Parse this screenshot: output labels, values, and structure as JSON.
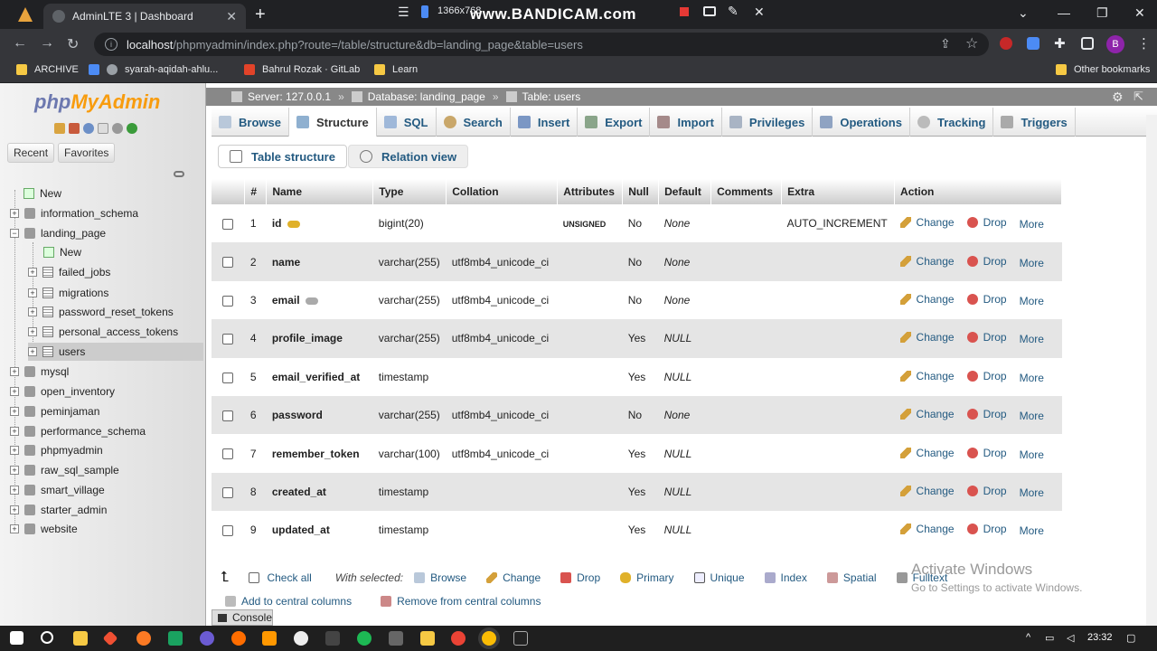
{
  "browser": {
    "tab_title": "AdminLTE 3 | Dashboard",
    "recording_res": "1366x768",
    "watermark": "www.BANDICAM.com",
    "url_host": "localhost",
    "url_path": "/phpmyadmin/index.php?route=/table/structure&db=landing_page&table=users",
    "profile_initial": "B",
    "bookmarks": [
      "ARCHIVE",
      "syarah-aqidah-ahlu...",
      "Bahrul Rozak · GitLab",
      "Learn"
    ],
    "other_bookmarks": "Other bookmarks"
  },
  "pma": {
    "logo_php": "php",
    "logo_my": "MyAdmin",
    "recent": "Recent",
    "favorites": "Favorites",
    "tree": {
      "new": "New",
      "dbs": [
        "information_schema",
        "landing_page",
        "mysql",
        "open_inventory",
        "peminjaman",
        "performance_schema",
        "phpmyadmin",
        "raw_sql_sample",
        "smart_village",
        "starter_admin",
        "website"
      ],
      "landing_new": "New",
      "tables": [
        "failed_jobs",
        "migrations",
        "password_reset_tokens",
        "personal_access_tokens",
        "users"
      ]
    },
    "breadcrumb": {
      "server": "Server: 127.0.0.1",
      "database": "Database: landing_page",
      "table": "Table: users"
    },
    "tabs": [
      "Browse",
      "Structure",
      "SQL",
      "Search",
      "Insert",
      "Export",
      "Import",
      "Privileges",
      "Operations",
      "Tracking",
      "Triggers"
    ],
    "subtabs": {
      "table_structure": "Table structure",
      "relation_view": "Relation view"
    },
    "columns": [
      "#",
      "Name",
      "Type",
      "Collation",
      "Attributes",
      "Null",
      "Default",
      "Comments",
      "Extra",
      "Action"
    ],
    "rows": [
      {
        "num": "1",
        "name": "id",
        "type": "bigint(20)",
        "collation": "",
        "attributes": "UNSIGNED",
        "null": "No",
        "default": "None",
        "extra": "AUTO_INCREMENT"
      },
      {
        "num": "2",
        "name": "name",
        "type": "varchar(255)",
        "collation": "utf8mb4_unicode_ci",
        "attributes": "",
        "null": "No",
        "default": "None",
        "extra": ""
      },
      {
        "num": "3",
        "name": "email",
        "type": "varchar(255)",
        "collation": "utf8mb4_unicode_ci",
        "attributes": "",
        "null": "No",
        "default": "None",
        "extra": ""
      },
      {
        "num": "4",
        "name": "profile_image",
        "type": "varchar(255)",
        "collation": "utf8mb4_unicode_ci",
        "attributes": "",
        "null": "Yes",
        "default": "NULL",
        "extra": ""
      },
      {
        "num": "5",
        "name": "email_verified_at",
        "type": "timestamp",
        "collation": "",
        "attributes": "",
        "null": "Yes",
        "default": "NULL",
        "extra": ""
      },
      {
        "num": "6",
        "name": "password",
        "type": "varchar(255)",
        "collation": "utf8mb4_unicode_ci",
        "attributes": "",
        "null": "No",
        "default": "None",
        "extra": ""
      },
      {
        "num": "7",
        "name": "remember_token",
        "type": "varchar(100)",
        "collation": "utf8mb4_unicode_ci",
        "attributes": "",
        "null": "Yes",
        "default": "NULL",
        "extra": ""
      },
      {
        "num": "8",
        "name": "created_at",
        "type": "timestamp",
        "collation": "",
        "attributes": "",
        "null": "Yes",
        "default": "NULL",
        "extra": ""
      },
      {
        "num": "9",
        "name": "updated_at",
        "type": "timestamp",
        "collation": "",
        "attributes": "",
        "null": "Yes",
        "default": "NULL",
        "extra": ""
      }
    ],
    "actions": {
      "change": "Change",
      "drop": "Drop",
      "more": "More"
    },
    "bulk": {
      "check_all": "Check all",
      "with_selected": "With selected:",
      "browse": "Browse",
      "change": "Change",
      "drop": "Drop",
      "primary": "Primary",
      "unique": "Unique",
      "index": "Index",
      "spatial": "Spatial",
      "fulltext": "Fulltext"
    },
    "central": {
      "add": "Add to central columns",
      "remove": "Remove from central columns"
    },
    "console": "Console"
  },
  "windows": {
    "activate_title": "Activate Windows",
    "activate_sub": "Go to Settings to activate Windows.",
    "clock": "23:32"
  },
  "colors": {
    "link": "#235a81",
    "drop": "#d9534f"
  }
}
